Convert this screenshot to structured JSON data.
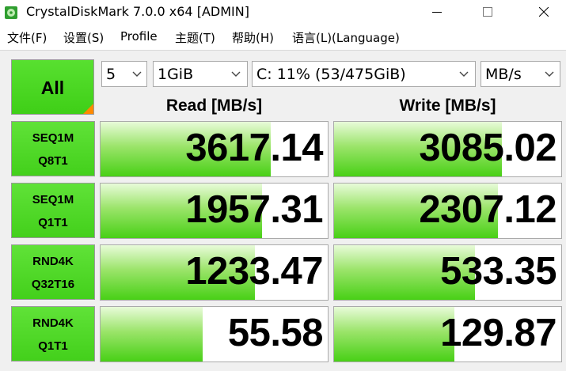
{
  "window": {
    "title": "CrystalDiskMark 7.0.0 x64 [ADMIN]"
  },
  "menu": [
    "文件(F)",
    "设置(S)",
    "Profile",
    "主题(T)",
    "帮助(H)",
    "语言(L)(Language)"
  ],
  "controls": {
    "all_label": "All",
    "count": "5",
    "size": "1GiB",
    "drive": "C: 11% (53/475GiB)",
    "unit": "MB/s"
  },
  "headers": {
    "read": "Read [MB/s]",
    "write": "Write [MB/s]"
  },
  "tests": [
    {
      "line1": "SEQ1M",
      "line2": "Q8T1",
      "read": "3617.14",
      "write": "3085.02",
      "read_fill": 0.75,
      "write_fill": 0.74
    },
    {
      "line1": "SEQ1M",
      "line2": "Q1T1",
      "read": "1957.31",
      "write": "2307.12",
      "read_fill": 0.71,
      "write_fill": 0.72
    },
    {
      "line1": "RND4K",
      "line2": "Q32T16",
      "read": "1233.47",
      "write": "533.35",
      "read_fill": 0.68,
      "write_fill": 0.62
    },
    {
      "line1": "RND4K",
      "line2": "Q1T1",
      "read": "55.58",
      "write": "129.87",
      "read_fill": 0.45,
      "write_fill": 0.53
    }
  ],
  "colors": {
    "accent_green": "#48d016",
    "corner_orange": "#ff8a00"
  }
}
